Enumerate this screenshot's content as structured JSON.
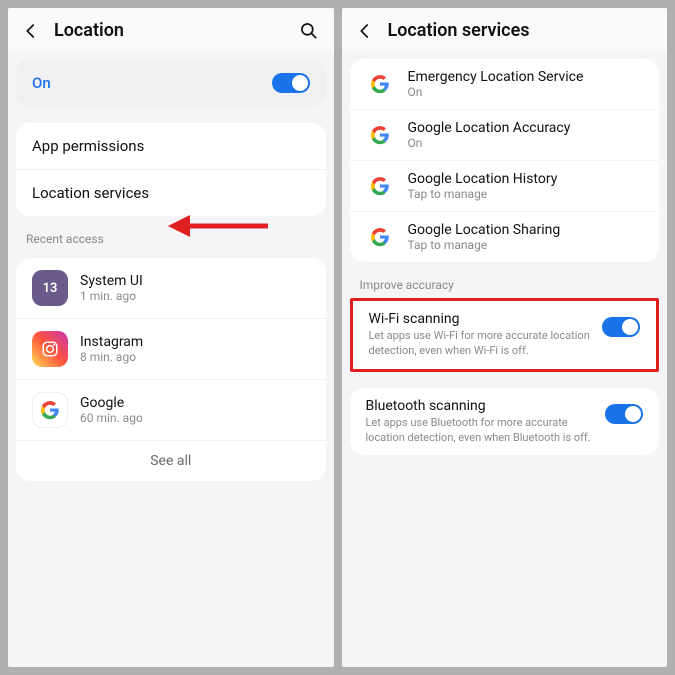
{
  "left": {
    "title": "Location",
    "on_label": "On",
    "rows": {
      "app_permissions": "App permissions",
      "location_services": "Location services"
    },
    "recent_label": "Recent access",
    "apps": [
      {
        "name": "System UI",
        "time": "1 min. ago",
        "bg": "#6b5b8a",
        "glyph": "13"
      },
      {
        "name": "Instagram",
        "time": "8 min. ago",
        "bg": "linear-gradient(45deg,#fd5,#ff543e,#c837ab)",
        "glyph": "◯"
      },
      {
        "name": "Google",
        "time": "60 min. ago",
        "bg": "#fff",
        "glyph": "G"
      }
    ],
    "see_all": "See all"
  },
  "right": {
    "title": "Location services",
    "services": [
      {
        "name": "Emergency Location Service",
        "sub": "On"
      },
      {
        "name": "Google Location Accuracy",
        "sub": "On"
      },
      {
        "name": "Google Location History",
        "sub": "Tap to manage"
      },
      {
        "name": "Google Location Sharing",
        "sub": "Tap to manage"
      }
    ],
    "improve_label": "Improve accuracy",
    "scans": [
      {
        "name": "Wi-Fi scanning",
        "desc": "Let apps use Wi-Fi for more accurate location detection, even when Wi-Fi is off."
      },
      {
        "name": "Bluetooth scanning",
        "desc": "Let apps use Bluetooth for more accurate location detection, even when Bluetooth is off."
      }
    ]
  }
}
